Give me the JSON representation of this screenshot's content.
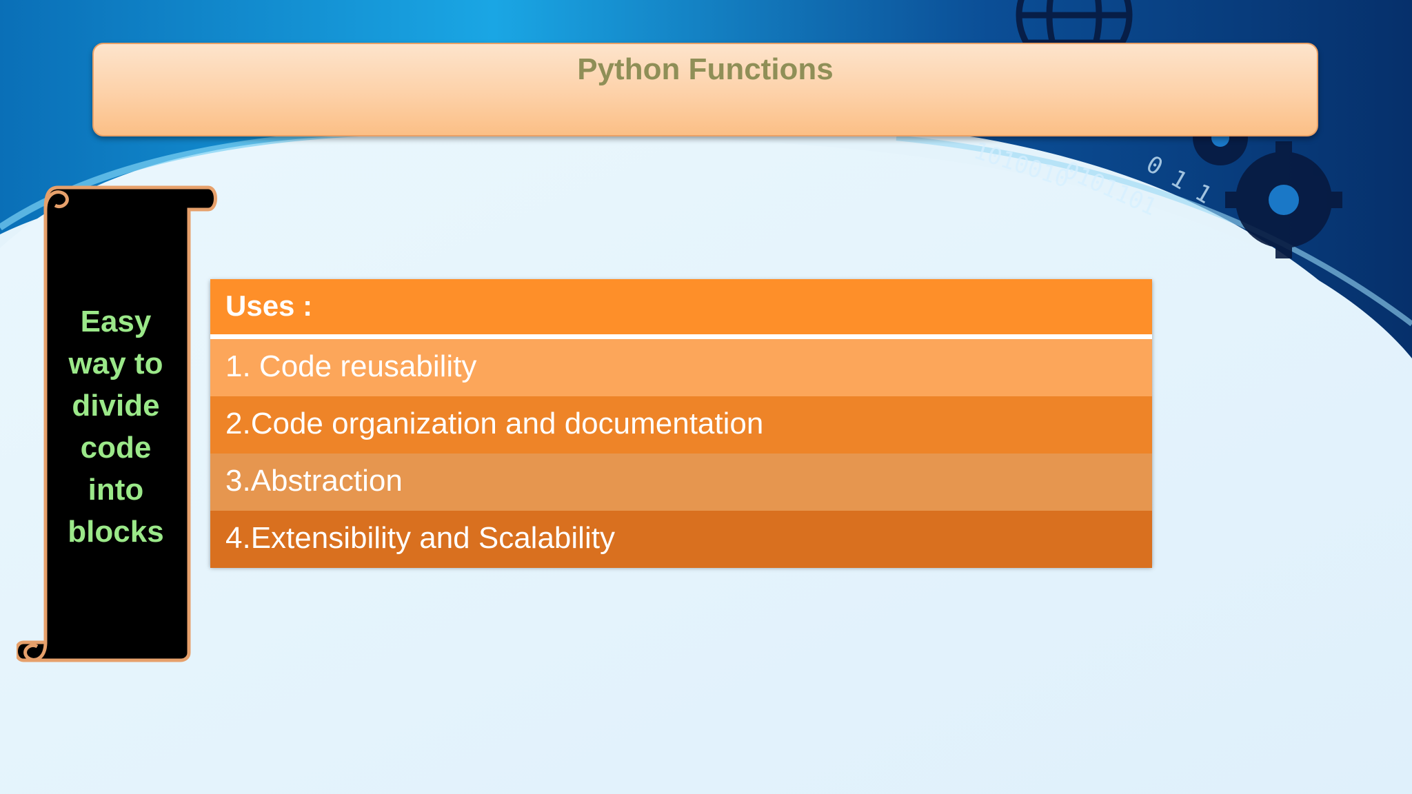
{
  "slide": {
    "title": "Python Functions",
    "scroll_text_lines": [
      "Easy",
      "way to",
      "divide",
      "code",
      "into",
      "blocks"
    ],
    "uses": {
      "header": "Uses :",
      "items": [
        "1. Code reusability",
        "2.Code organization and documentation",
        "3.Abstraction",
        "4.Extensibility and Scalability"
      ]
    }
  },
  "colors": {
    "title_text": "#8f8f57",
    "scroll_text": "#9be889",
    "header_orange": "#fe8f29"
  }
}
